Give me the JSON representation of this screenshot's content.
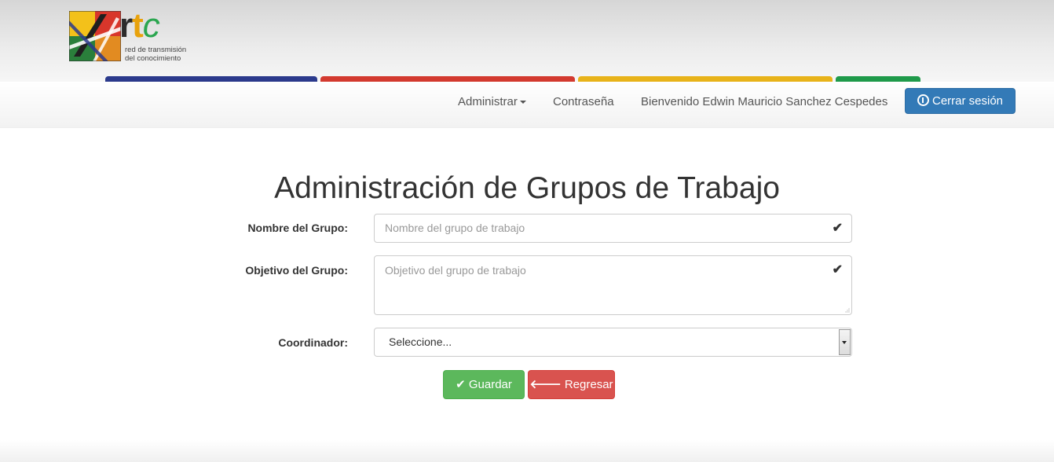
{
  "logo": {
    "letters": {
      "r": "r",
      "t": "t",
      "c": "c"
    },
    "tagline_line1": "red de transmisión",
    "tagline_line2": "del conocimiento"
  },
  "stripes": [
    "#2b3a8c",
    "#d33a2f",
    "#e8b31a",
    "#1f9a4a"
  ],
  "navbar": {
    "admin_label": "Administrar",
    "password_label": "Contraseña",
    "welcome_text": "Bienvenido Edwin Mauricio Sanchez Cespedes",
    "logout_label": "Cerrar sesión"
  },
  "page": {
    "title": "Administración de Grupos de Trabajo"
  },
  "form": {
    "name_label": "Nombre del Grupo:",
    "name_placeholder": "Nombre del grupo de trabajo",
    "objective_label": "Objetivo del Grupo:",
    "objective_placeholder": "Objetivo del grupo de trabajo",
    "coordinator_label": "Coordinador:",
    "coordinator_selected": "Seleccione...",
    "check_glyph": "✔",
    "save_label": "Guardar",
    "back_label": "Regresar"
  },
  "icons": {
    "check": "check-icon",
    "arrow_left": "arrow-left-icon",
    "power": "power-icon",
    "caret": "caret-down-icon"
  },
  "colors": {
    "primary": "#337ab7",
    "success": "#5cb85c",
    "danger": "#d9534f"
  }
}
